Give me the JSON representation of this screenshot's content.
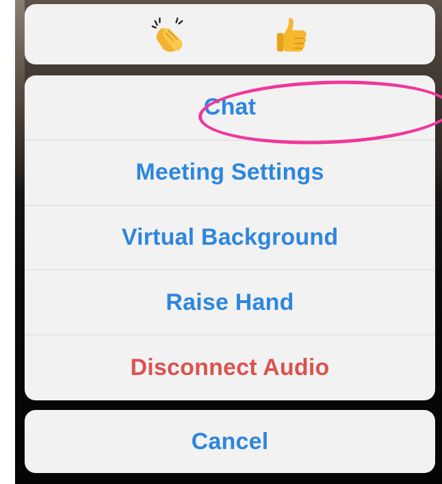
{
  "reactions": [
    {
      "name": "clap",
      "icon": "clapping-hands-icon"
    },
    {
      "name": "thumbs_up",
      "icon": "thumbs-up-icon"
    }
  ],
  "actions": {
    "items": [
      {
        "id": "chat",
        "label": "Chat",
        "style": "default"
      },
      {
        "id": "meeting_settings",
        "label": "Meeting Settings",
        "style": "default"
      },
      {
        "id": "virtual_background",
        "label": "Virtual Background",
        "style": "default"
      },
      {
        "id": "raise_hand",
        "label": "Raise Hand",
        "style": "default"
      },
      {
        "id": "disconnect_audio",
        "label": "Disconnect Audio",
        "style": "destructive"
      }
    ]
  },
  "cancel": {
    "label": "Cancel"
  },
  "colors": {
    "action_blue": "#2e86de",
    "destructive_red": "#d9534f",
    "highlight_pink": "#f0379a",
    "sheet_bg": "#f2f2f2"
  }
}
